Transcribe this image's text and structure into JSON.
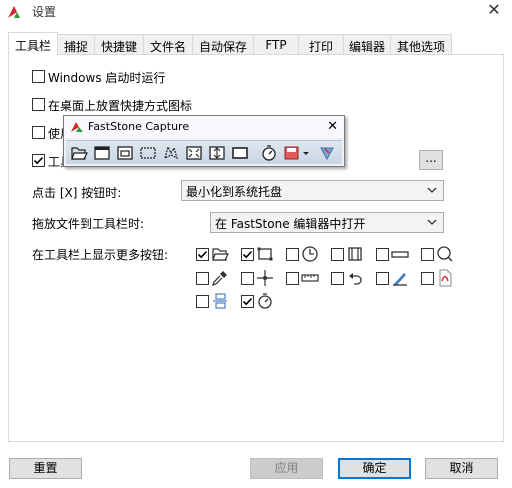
{
  "window": {
    "title": "设置"
  },
  "tabs": [
    {
      "label": "工具栏",
      "active": true
    },
    {
      "label": "捕捉"
    },
    {
      "label": "快捷键"
    },
    {
      "label": "文件名"
    },
    {
      "label": "自动保存"
    },
    {
      "label": "FTP"
    },
    {
      "label": "打印"
    },
    {
      "label": "编辑器"
    },
    {
      "label": "其他选项"
    }
  ],
  "options": [
    {
      "label": "Windows 启动时运行",
      "checked": false
    },
    {
      "label": "在桌面上放置快捷方式图标",
      "checked": false
    },
    {
      "label": "使用",
      "checked": false
    },
    {
      "label": "工具",
      "checked": true
    }
  ],
  "close_action": {
    "label": "点击 [X] 按钮时:",
    "value": "最小化到系统托盘"
  },
  "drag_action": {
    "label": "拖放文件到工具栏时:",
    "value": "在 FastStone 编辑器中打开"
  },
  "more_buttons": {
    "label": "在工具栏上显示更多按钮:"
  },
  "extra_buttons": [
    {
      "icon": "open-folder-icon",
      "checked": true
    },
    {
      "icon": "fixed-region-icon",
      "checked": true
    },
    {
      "icon": "delay-timer-icon",
      "checked": false
    },
    {
      "icon": "video-recorder-icon",
      "checked": false
    },
    {
      "icon": "scrolling-bar-icon",
      "checked": false
    },
    {
      "icon": "magnifier-icon",
      "checked": false
    },
    {
      "icon": "color-picker-icon",
      "checked": false
    },
    {
      "icon": "crosshair-icon",
      "checked": false
    },
    {
      "icon": "ruler-icon",
      "checked": false
    },
    {
      "icon": "undo-arrow-icon",
      "checked": false
    },
    {
      "icon": "screen-pen-icon",
      "checked": false
    },
    {
      "icon": "pdf-icon",
      "checked": false
    },
    {
      "icon": "split-panels-icon",
      "checked": false
    },
    {
      "icon": "stopwatch-icon",
      "checked": true
    }
  ],
  "popup": {
    "title": "FastStone Capture",
    "buttons": [
      "open-folder-icon",
      "window-capture-icon",
      "object-capture-icon",
      "rectangle-capture-icon",
      "freehand-capture-icon",
      "fullscreen-capture-icon",
      "scrolling-capture-icon",
      "fixed-region-icon",
      "delay-timer-icon",
      "output-icon",
      "settings-icon"
    ]
  },
  "dots_label": "...",
  "footer": {
    "reset": "重置",
    "apply": "应用",
    "ok": "确定",
    "cancel": "取消"
  },
  "colors": {
    "accent": "#0078d7",
    "checked_mark": "#000000"
  }
}
